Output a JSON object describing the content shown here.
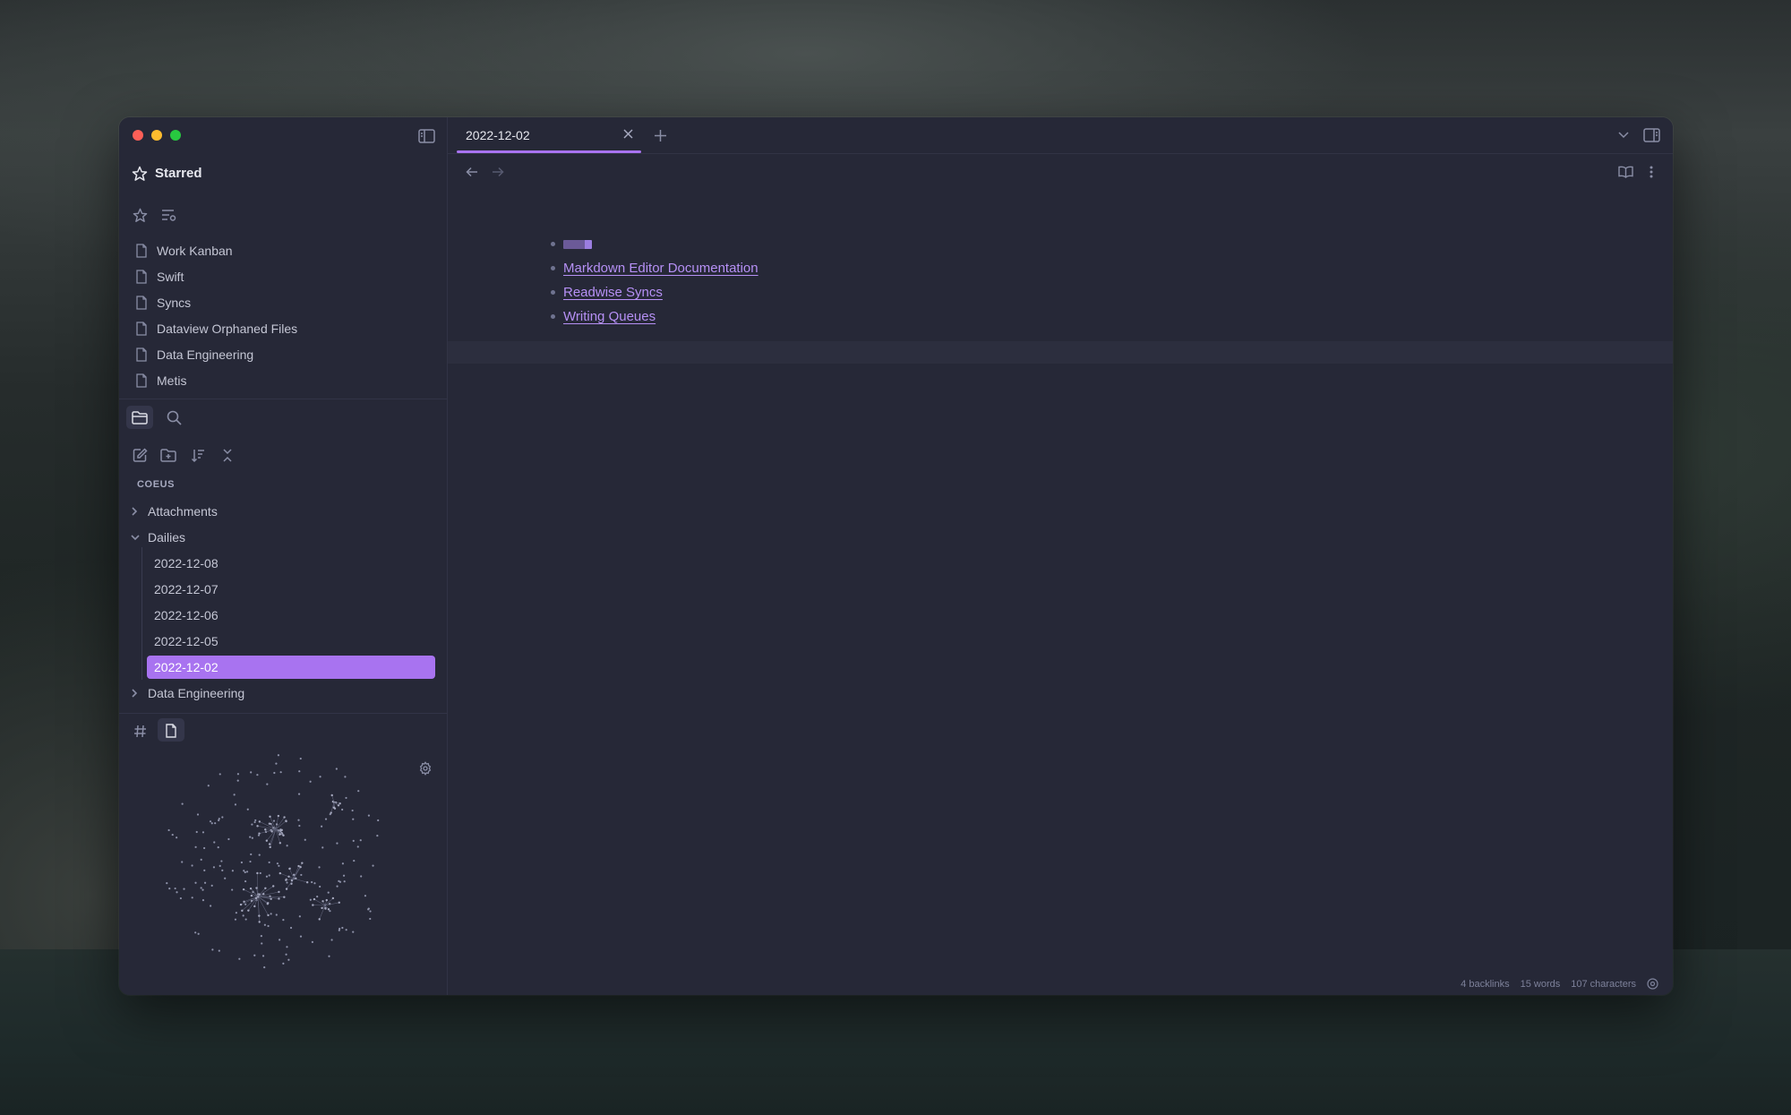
{
  "app": {
    "accent_color": "#a873f0",
    "link_color": "#b690f5"
  },
  "sidebar": {
    "starred_title": "Starred",
    "starred_items": [
      {
        "label": "Work Kanban",
        "icon": "file-icon"
      },
      {
        "label": "Swift",
        "icon": "file-icon"
      },
      {
        "label": "Syncs",
        "icon": "file-icon"
      },
      {
        "label": "Dataview Orphaned Files",
        "icon": "file-icon"
      },
      {
        "label": "Data Engineering",
        "icon": "file-icon"
      },
      {
        "label": "Metis",
        "icon": "file-icon"
      }
    ],
    "vault_name": "COEUS",
    "tree": {
      "attachments": "Attachments",
      "dailies": "Dailies",
      "daily_notes": [
        "2022-12-08",
        "2022-12-07",
        "2022-12-06",
        "2022-12-05"
      ],
      "active_note": "2022-12-02",
      "data_engineering": "Data Engineering"
    }
  },
  "tabs": {
    "active_title": "2022-12-02"
  },
  "editor": {
    "links": [
      "Markdown Editor Documentation",
      "Readwise Syncs",
      "Writing Queues"
    ]
  },
  "status_bar": {
    "backlinks": "4 backlinks",
    "words": "15 words",
    "characters": "107 characters"
  }
}
